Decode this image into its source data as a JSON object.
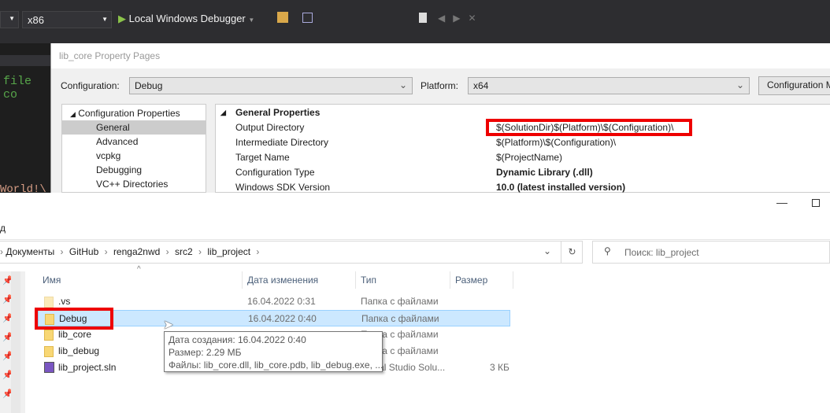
{
  "vs": {
    "platform_dropdown": "x86",
    "debugger_label": "Local Windows Debugger",
    "code_fragment": "file co",
    "code_fragment2": "World!\\"
  },
  "dialog": {
    "title": "lib_core Property Pages",
    "configuration_label": "Configuration:",
    "configuration_value": "Debug",
    "platform_label": "Platform:",
    "platform_value": "x64",
    "config_manager_button": "Configuration Manager...",
    "tree": {
      "root": "Configuration Properties",
      "items": [
        "General",
        "Advanced",
        "vcpkg",
        "Debugging",
        "VC++ Directories"
      ]
    },
    "grid": {
      "section": "General Properties",
      "rows": [
        {
          "key": "Output Directory",
          "value": "$(SolutionDir)$(Platform)\\$(Configuration)\\"
        },
        {
          "key": "Intermediate Directory",
          "value": "$(Platform)\\$(Configuration)\\"
        },
        {
          "key": "Target Name",
          "value": "$(ProjectName)"
        },
        {
          "key": "Configuration Type",
          "value": "Dynamic Library (.dll)"
        },
        {
          "key": "Windows SDK Version",
          "value": "10.0 (latest installed version)"
        }
      ]
    }
  },
  "explorer": {
    "ribbon_fragment": "д",
    "breadcrumb": [
      "Документы",
      "GitHub",
      "renga2nwd",
      "src2",
      "lib_project"
    ],
    "search_placeholder": "Поиск: lib_project",
    "columns": [
      "Имя",
      "Дата изменения",
      "Тип",
      "Размер"
    ],
    "files": [
      {
        "name": ".vs",
        "date": "16.04.2022 0:31",
        "type": "Папка с файлами",
        "size": ""
      },
      {
        "name": "Debug",
        "date": "16.04.2022 0:40",
        "type": "Папка с файлами",
        "size": ""
      },
      {
        "name": "lib_core",
        "date": "",
        "type": "Папка с файлами",
        "size": ""
      },
      {
        "name": "lib_debug",
        "date": "",
        "type": "Папка с файлами",
        "size": ""
      },
      {
        "name": "lib_project.sln",
        "date": "",
        "type": "Visual Studio Solu...",
        "size": "3 КБ"
      }
    ],
    "tooltip": {
      "line1": "Дата создания: 16.04.2022 0:40",
      "line2": "Размер: 2.29 МБ",
      "line3": "Файлы: lib_core.dll, lib_core.pdb, lib_debug.exe, ..."
    }
  }
}
